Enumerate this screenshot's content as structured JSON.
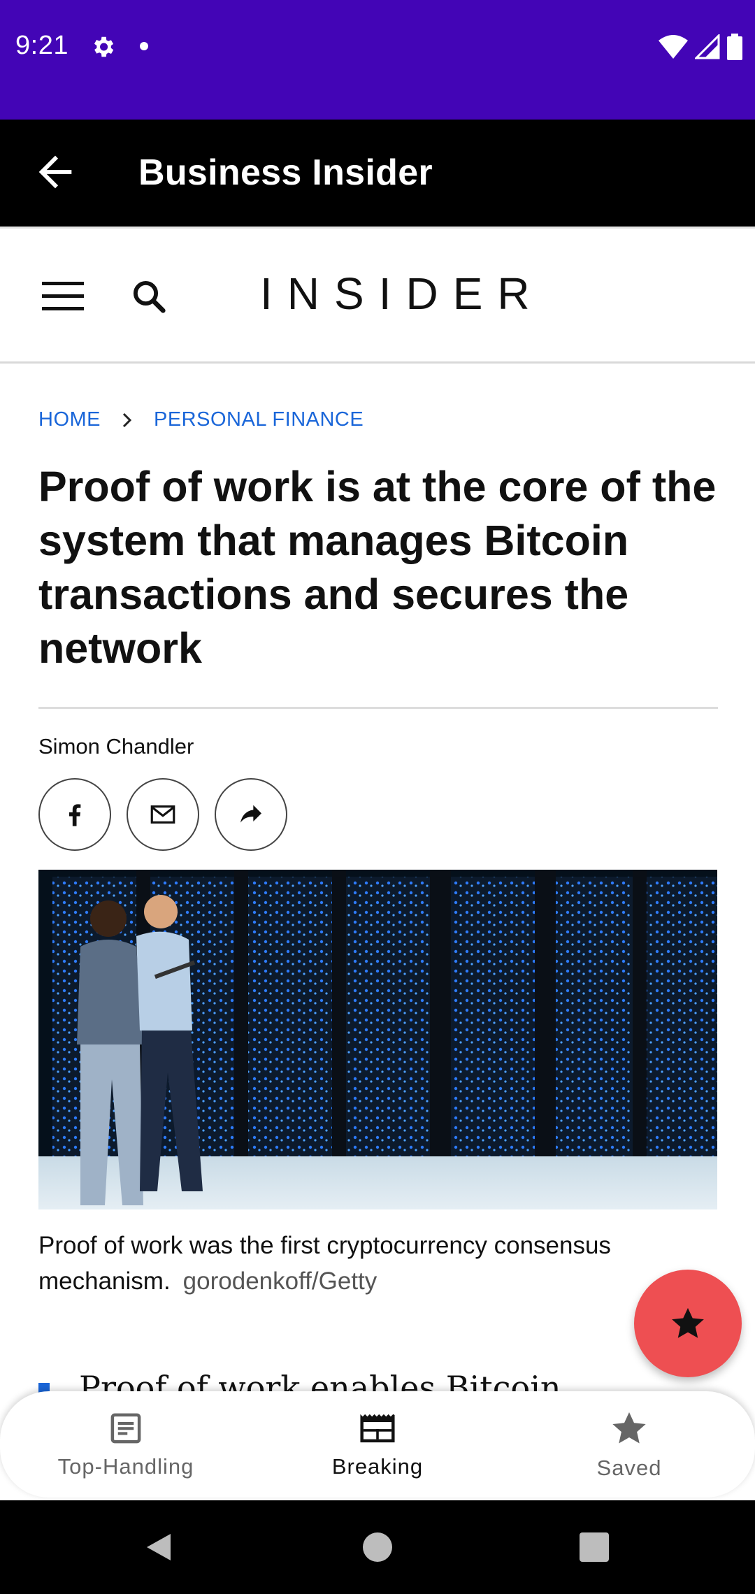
{
  "status_bar": {
    "time": "9:21",
    "icons": [
      "gear-icon",
      "dot-icon",
      "wifi-icon",
      "signal-icon",
      "battery-icon"
    ]
  },
  "app_bar": {
    "title": "Business Insider",
    "back_icon": "arrow-left-icon"
  },
  "site_header": {
    "logo": "INSIDER",
    "menu_icon": "hamburger-menu-icon",
    "search_icon": "search-icon"
  },
  "breadcrumb": {
    "items": [
      "HOME",
      "PERSONAL FINANCE"
    ]
  },
  "article": {
    "headline": "Proof of work is at the core of the system that manages Bitcoin transactions and secures the network",
    "author": "Simon Chandler",
    "share_buttons": [
      "facebook-icon",
      "email-icon",
      "share-forward-icon"
    ],
    "image_caption": "Proof of work was the first cryptocurrency consensus mechanism.",
    "image_credit": "gorodenkoff/Getty",
    "first_bullet": "Proof of work enables Bitcoin"
  },
  "fab": {
    "icon": "star-icon"
  },
  "bottom_nav": {
    "items": [
      {
        "label": "Top-Handling",
        "icon": "article-icon",
        "active": false
      },
      {
        "label": "Breaking",
        "icon": "newspaper-icon",
        "active": true
      },
      {
        "label": "Saved",
        "icon": "star-icon",
        "active": false
      }
    ]
  },
  "colors": {
    "status_bar": "#4305b6",
    "app_bar": "#000000",
    "link_blue": "#1a66d9",
    "fab_red": "#ee4f52"
  }
}
